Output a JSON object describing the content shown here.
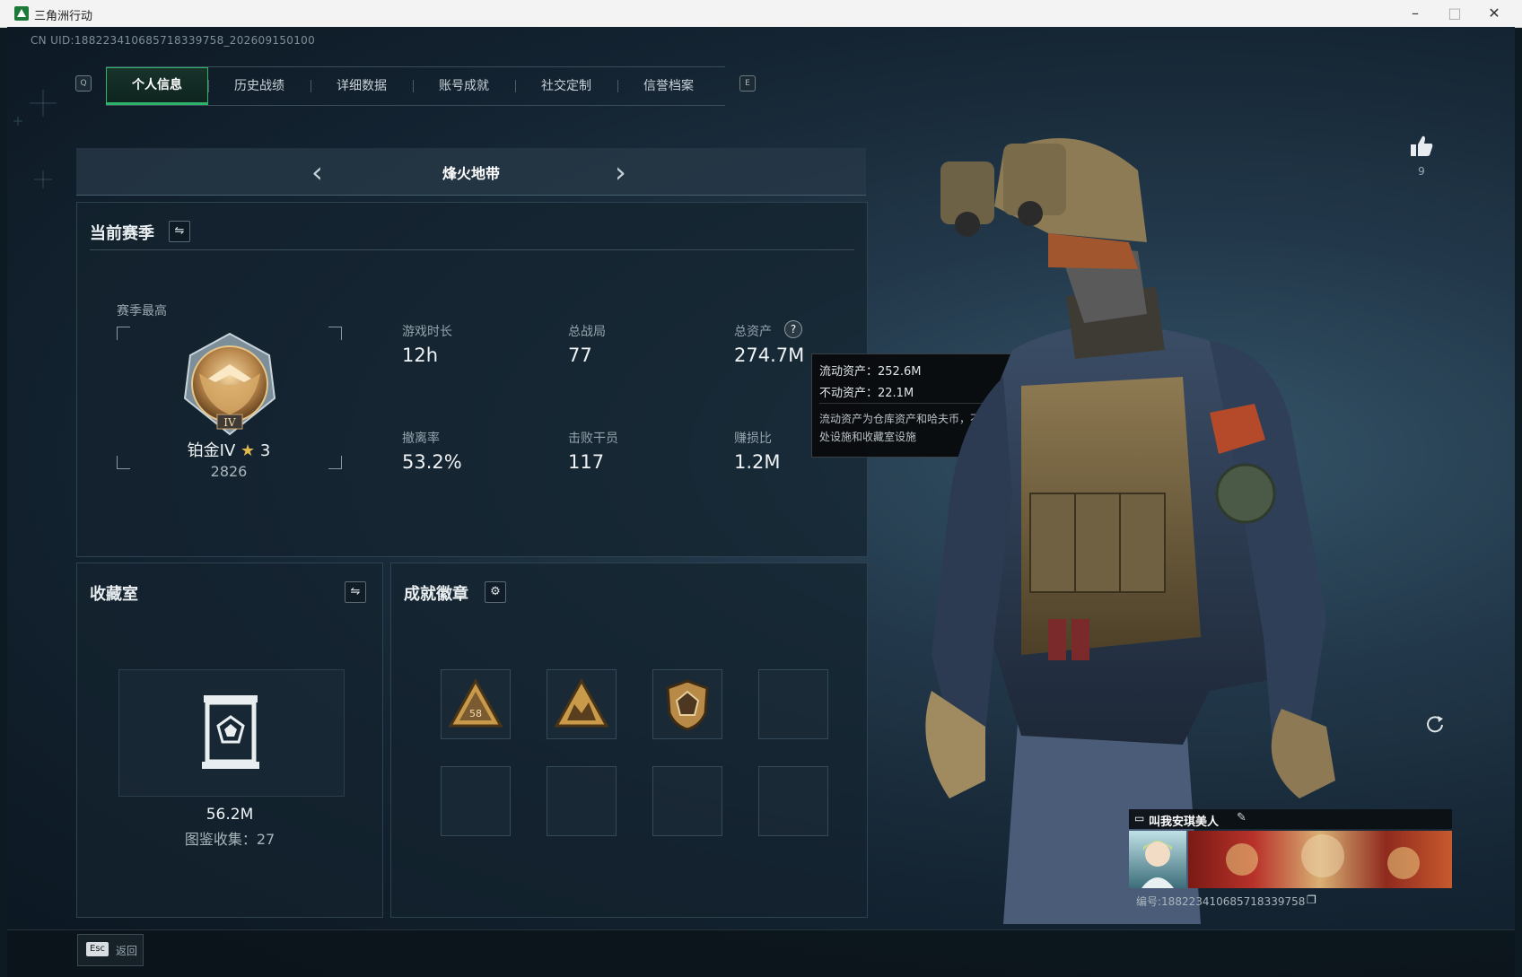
{
  "window": {
    "title": "三角洲行动",
    "min": "–",
    "max": "□",
    "close": "✕"
  },
  "uid_text": "CN UID:18822341068571833975​8_202609150100",
  "tabs": {
    "left_key": "Q",
    "right_key": "E",
    "items": [
      {
        "label": "个人信息",
        "active": true
      },
      {
        "label": "历史战绩"
      },
      {
        "label": "详细数据"
      },
      {
        "label": "账号成就"
      },
      {
        "label": "社交定制"
      },
      {
        "label": "信誉档案"
      }
    ]
  },
  "mode": {
    "name": "烽火地带",
    "prev": "‹",
    "next": "›"
  },
  "season": {
    "title": "当前赛季",
    "best_label": "赛季最高",
    "rank_name": "铂金IV",
    "rank_stars": "3",
    "rank_score": "2826",
    "stats": [
      {
        "label": "游戏时长",
        "value": "12h"
      },
      {
        "label": "总战局",
        "value": "77"
      },
      {
        "label": "总资产",
        "value": "274.7M"
      },
      {
        "label": "撤离率",
        "value": "53.2%"
      },
      {
        "label": "击败干员",
        "value": "117"
      },
      {
        "label": "赚损比",
        "value": "1.2M"
      }
    ]
  },
  "tooltip": {
    "liquid": "流动资产：252.6M",
    "fixed": "不动资产：22.1M",
    "desc": "流动资产为仓库资产和哈夫币，不动资产为特勤处设施和收藏室设施"
  },
  "collection": {
    "title": "收藏室",
    "value": "56.2M",
    "count": "图鉴收集：27"
  },
  "badges": {
    "title": "成就徽章",
    "slot1_text": "58"
  },
  "likes": {
    "count": "9"
  },
  "card": {
    "name": "叫我安琪美人",
    "id": "编号:18822341068571833975​8"
  },
  "footer": {
    "key": "Esc",
    "label": "返回"
  }
}
